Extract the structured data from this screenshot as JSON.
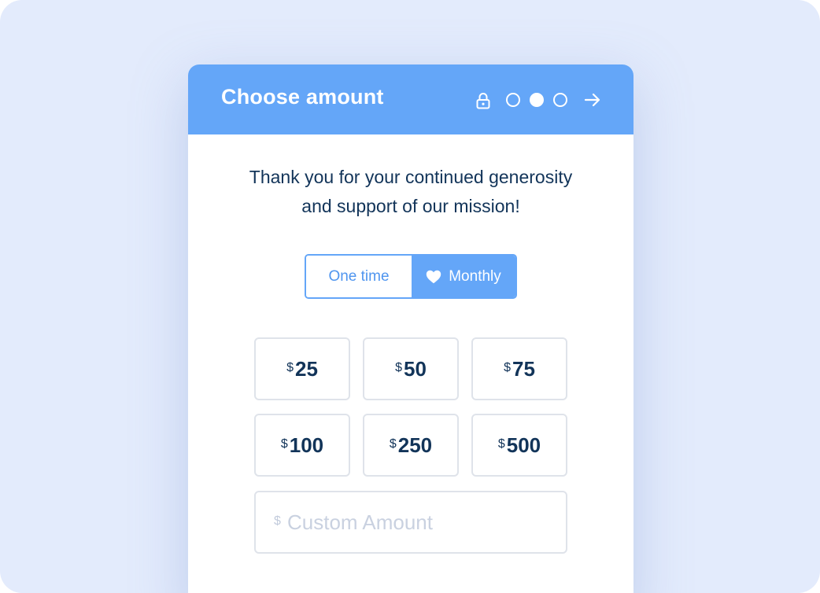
{
  "header": {
    "title": "Choose amount",
    "lock_icon": "lock-icon",
    "steps": [
      {
        "state": "inactive"
      },
      {
        "state": "active"
      },
      {
        "state": "inactive"
      }
    ],
    "next_icon": "arrow-right-icon"
  },
  "message": {
    "line1": "Thank you for your continued generosity",
    "line2": "and support of our mission!"
  },
  "frequency": {
    "options": [
      {
        "label": "One time",
        "selected": false
      },
      {
        "label": "Monthly",
        "selected": true,
        "icon": "heart-icon"
      }
    ]
  },
  "currency_symbol": "$",
  "amounts": [
    {
      "value": "25"
    },
    {
      "value": "50"
    },
    {
      "value": "75"
    },
    {
      "value": "100"
    },
    {
      "value": "250"
    },
    {
      "value": "500"
    }
  ],
  "custom_amount": {
    "currency_symbol": "$",
    "placeholder": "Custom Amount",
    "value": ""
  },
  "colors": {
    "accent": "#64a6f8",
    "text_primary": "#123459",
    "backdrop": "#e3ebfc",
    "border": "#dfe3ea"
  }
}
